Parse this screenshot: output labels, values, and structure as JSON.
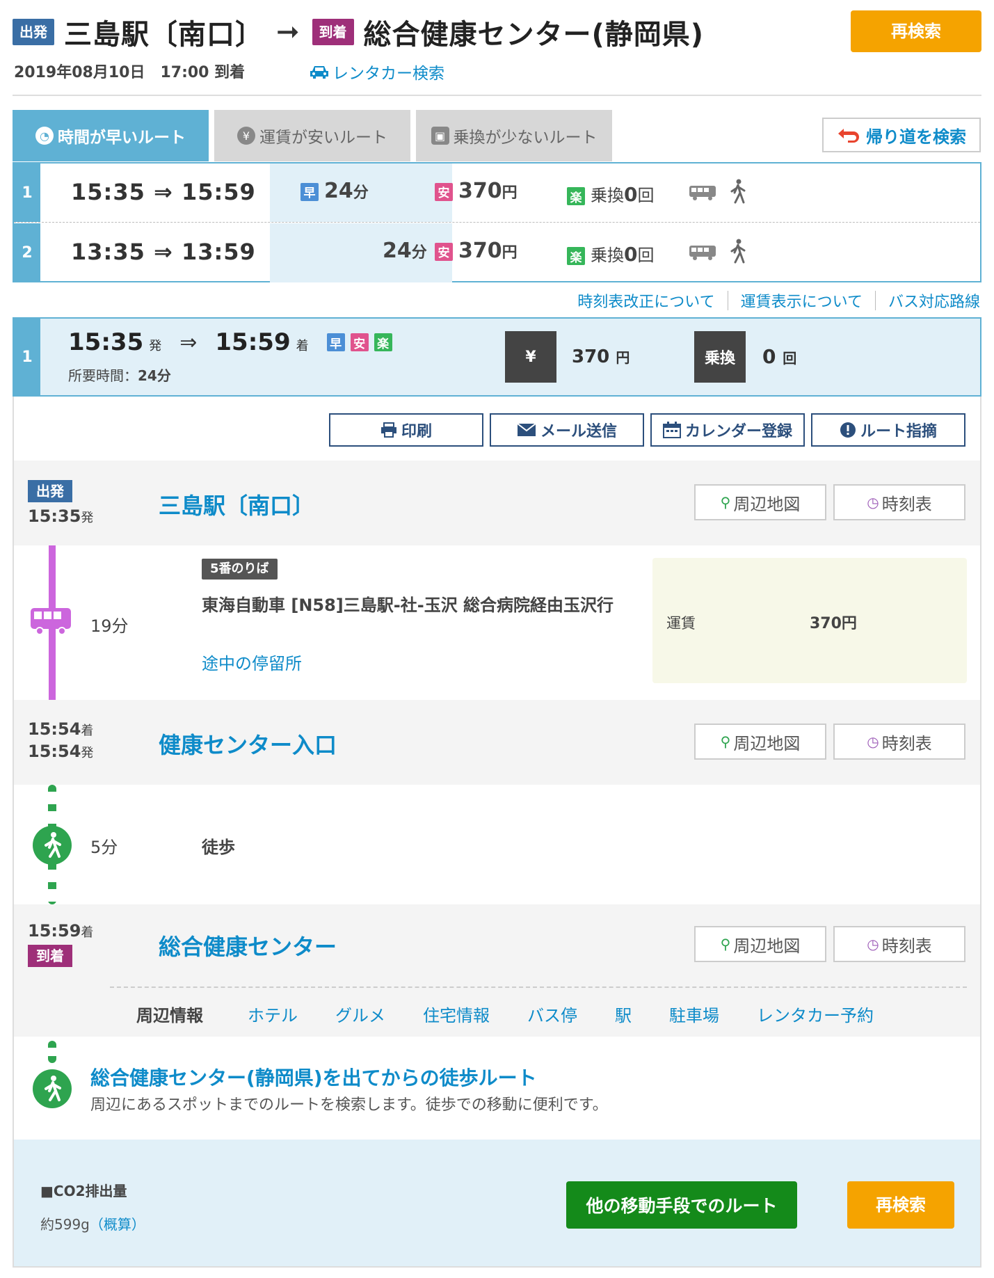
{
  "header": {
    "dep_tag": "出発",
    "from": "三島駅〔南口〕",
    "arrow": "➞",
    "arr_tag": "到着",
    "to": "総合健康センター(静岡県)",
    "research_button": "再検索",
    "date_line": "2019年08月10日　17:00 到着",
    "rental_link": "レンタカー検索"
  },
  "tabs": [
    {
      "label": "時間が早いルート",
      "active": true
    },
    {
      "label": "運賃が安いルート",
      "active": false
    },
    {
      "label": "乗換が少ないルート",
      "active": false
    }
  ],
  "return_button": "帰り道を検索",
  "routes": [
    {
      "num": "1",
      "time": "15:35 ⇒ 15:59",
      "fast": "早",
      "duration": "24",
      "duration_unit": "分",
      "cheap": "安",
      "fare": "370",
      "fare_unit": "円",
      "easy": "楽",
      "transfer_label": "乗換",
      "transfers": "0",
      "transfer_unit": "回"
    },
    {
      "num": "2",
      "time": "13:35 ⇒ 13:59",
      "duration": "24",
      "duration_unit": "分",
      "cheap": "安",
      "fare": "370",
      "fare_unit": "円",
      "easy": "楽",
      "transfer_label": "乗換",
      "transfers": "0",
      "transfer_unit": "回"
    }
  ],
  "info_links": [
    "時刻表改正について",
    "運賃表示について",
    "バス対応路線"
  ],
  "detail": {
    "num": "1",
    "dep_time": "15:35",
    "dep_suffix": "発",
    "arrow": "⇒",
    "arr_time": "15:59",
    "arr_suffix": "着",
    "badges": [
      "早",
      "安",
      "楽"
    ],
    "duration_label": "所要時間：",
    "duration_value": "24分",
    "yen_label": "¥",
    "fare": "370",
    "fare_unit": "円",
    "transfer_label": "乗換",
    "transfers": "0",
    "transfer_unit": "回"
  },
  "actions": [
    "印刷",
    "メール送信",
    "カレンダー登録",
    "ルート指摘"
  ],
  "stops": {
    "s1": {
      "tag": "出発",
      "time": "15:35",
      "suffix": "発",
      "name": "三島駅〔南口〕"
    },
    "s2": {
      "time1": "15:54",
      "suffix1": "着",
      "time2": "15:54",
      "suffix2": "発",
      "name": "健康センター入口"
    },
    "s3": {
      "time": "15:59",
      "suffix": "着",
      "tag": "到着",
      "name": "総合健康センター"
    }
  },
  "stop_buttons": {
    "map": "周辺地図",
    "timetable": "時刻表"
  },
  "segment_bus": {
    "platform": "5番のりば",
    "duration": "19分",
    "line": "東海自動車 [N58]三島駅-社-玉沢 総合病院経由玉沢行",
    "stops_link": "途中の停留所",
    "fare_label": "運賃",
    "fare_value": "370円"
  },
  "segment_walk": {
    "duration": "5分",
    "label": "徒歩"
  },
  "nearby": {
    "label": "周辺情報",
    "links": [
      "ホテル",
      "グルメ",
      "住宅情報",
      "バス停",
      "駅",
      "駐車場",
      "レンタカー予約"
    ]
  },
  "walk_route": {
    "title": "総合健康センター(静岡県)を出てからの徒歩ルート",
    "desc": "周辺にあるスポットまでのルートを検索します。徒歩での移動に便利です。"
  },
  "co2": {
    "label": "■CO2排出量",
    "value": "約599g",
    "note": "（概算）"
  },
  "footer_buttons": {
    "other": "他の移動手段でのルート",
    "research": "再検索"
  },
  "colors": {
    "accent_blue": "#5fb1d4",
    "link_blue": "#0e8bc9",
    "bus_purple": "#cc66dd",
    "walk_green": "#2ea44f",
    "orange": "#f5a300",
    "green_button": "#148a1a"
  }
}
